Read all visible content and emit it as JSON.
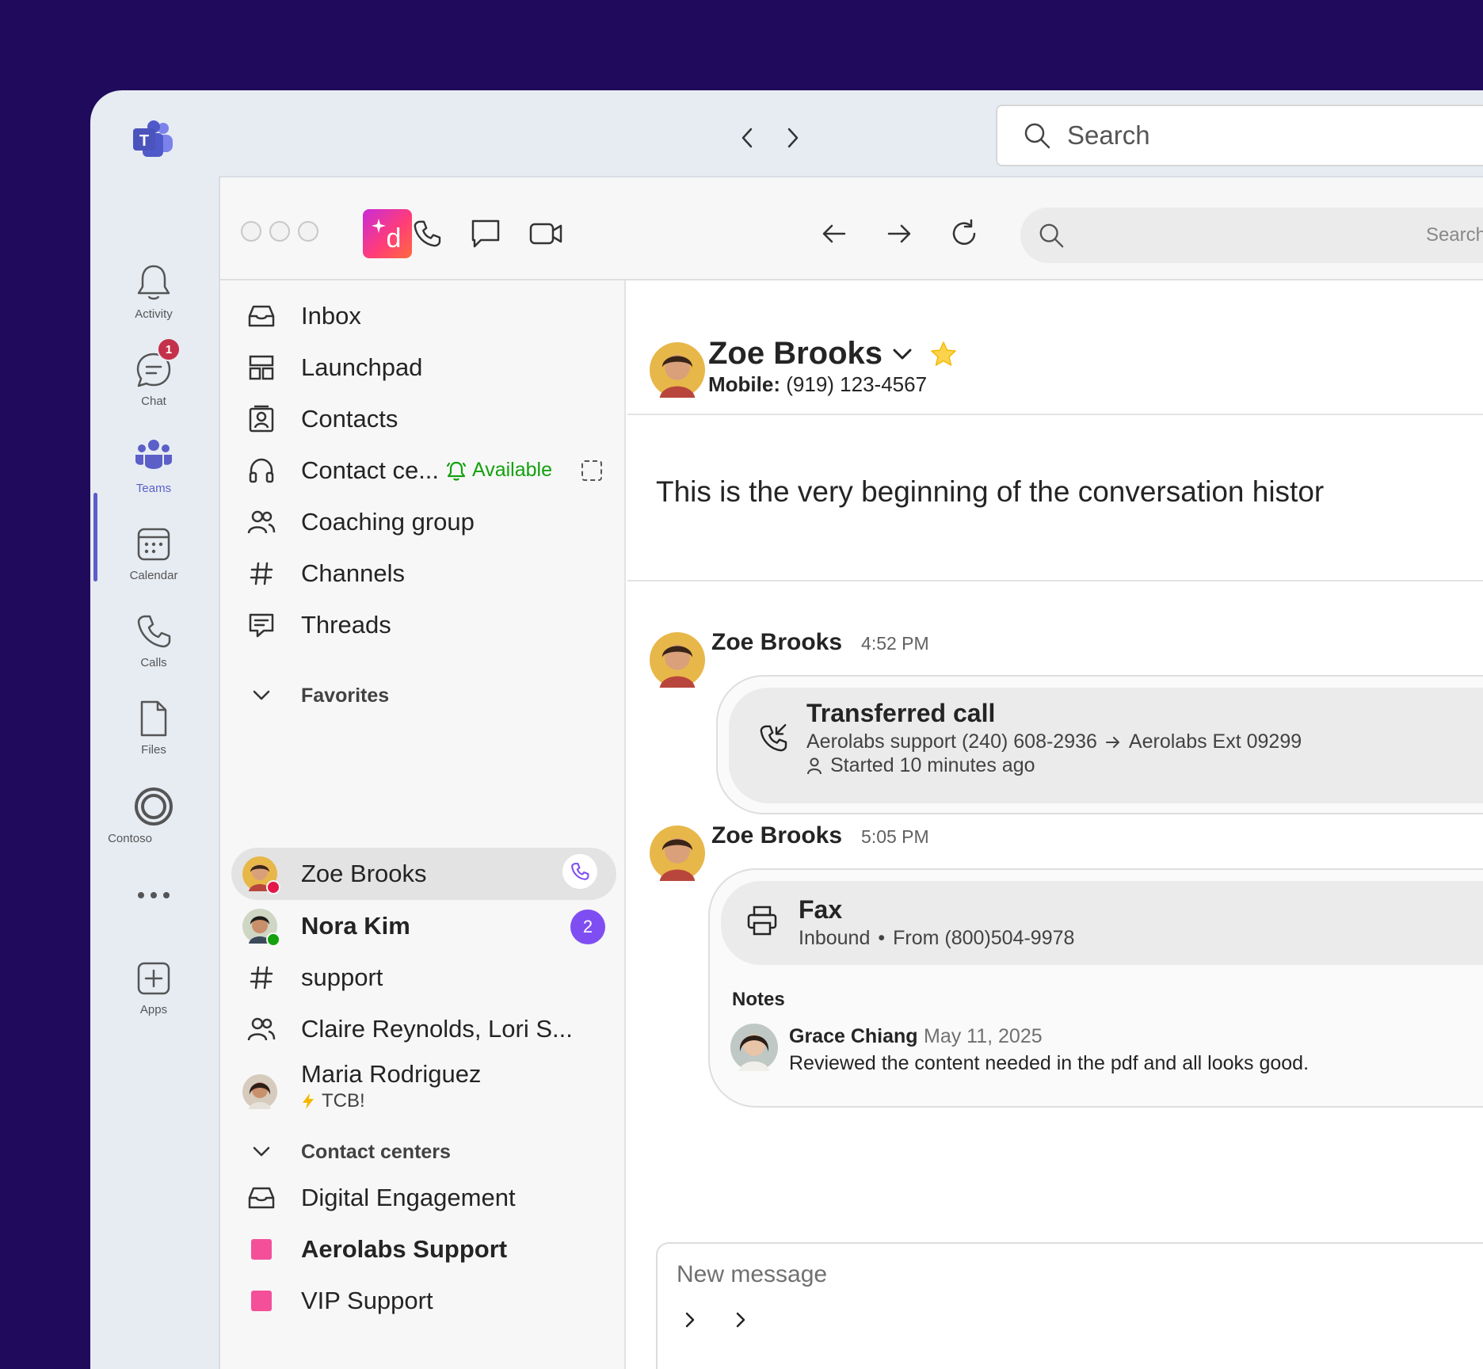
{
  "teams": {
    "nav_back": "back",
    "nav_forward": "forward",
    "search_placeholder": "Search",
    "rail": [
      {
        "label": "Activity",
        "icon": "bell-icon"
      },
      {
        "label": "Chat",
        "icon": "chat-icon",
        "badge": "1"
      },
      {
        "label": "Teams",
        "icon": "teams-icon",
        "active": true
      },
      {
        "label": "Calendar",
        "icon": "calendar-icon"
      },
      {
        "label": "Calls",
        "icon": "phone-icon"
      },
      {
        "label": "Files",
        "icon": "file-icon"
      },
      {
        "label": "Contoso",
        "icon": "contoso-icon"
      },
      {
        "label": "Apps",
        "icon": "add-app-icon"
      }
    ]
  },
  "app": {
    "logo_letter": "d",
    "search_placeholder": "Search",
    "nav": [
      {
        "label": "Inbox",
        "icon": "inbox-icon"
      },
      {
        "label": "Launchpad",
        "icon": "launchpad-icon"
      },
      {
        "label": "Contacts",
        "icon": "contacts-icon"
      },
      {
        "label": "Contact ce...",
        "icon": "headset-icon",
        "status": "Available"
      },
      {
        "label": "Coaching group",
        "icon": "people-icon"
      },
      {
        "label": "Channels",
        "icon": "hash-icon"
      },
      {
        "label": "Threads",
        "icon": "threads-icon"
      }
    ],
    "favorites": {
      "title": "Favorites",
      "items": [
        {
          "label": "Zoe Brooks",
          "presence": "busy",
          "selected": true
        },
        {
          "label": "Nora Kim",
          "presence": "available",
          "badge": "2",
          "bold": true
        },
        {
          "label": "support",
          "icon": "hash-icon"
        },
        {
          "label": "Claire Reynolds, Lori S...",
          "icon": "people-icon"
        },
        {
          "label": "Maria Rodriguez",
          "sub": "TCB!"
        }
      ]
    },
    "contact_centers": {
      "title": "Contact centers",
      "items": [
        {
          "label": "Digital Engagement",
          "icon": "inbox-icon"
        },
        {
          "label": "Aerolabs Support",
          "bold": true
        },
        {
          "label": "VIP Support"
        }
      ]
    }
  },
  "conversation": {
    "name": "Zoe Brooks",
    "mobile_label": "Mobile:",
    "mobile": "(919) 123-4567",
    "beginning_text": "This is the very beginning of the conversation histor",
    "messages": [
      {
        "author": "Zoe Brooks",
        "time": "4:52 PM",
        "card_title": "Transferred call",
        "from": "Aerolabs support (240) 608-2936",
        "to": "Aerolabs Ext 09299",
        "started": "Started 10 minutes ago"
      },
      {
        "author": "Zoe Brooks",
        "time": "5:05 PM",
        "card_title": "Fax",
        "direction": "Inbound",
        "from": "From (800)504-9978",
        "notes_label": "Notes",
        "note_author": "Grace Chiang",
        "note_date": "May 11, 2025",
        "note_text": "Reviewed the content needed in the pdf and all looks good."
      }
    ],
    "composer_placeholder": "New message"
  },
  "colors": {
    "background": "#1f0a5b",
    "teams_accent": "#5b5fc7",
    "available_green": "#13a10e",
    "badge_purple": "#7f4ef2",
    "pink_square": "#f4509a",
    "busy_red": "#e3194a"
  }
}
